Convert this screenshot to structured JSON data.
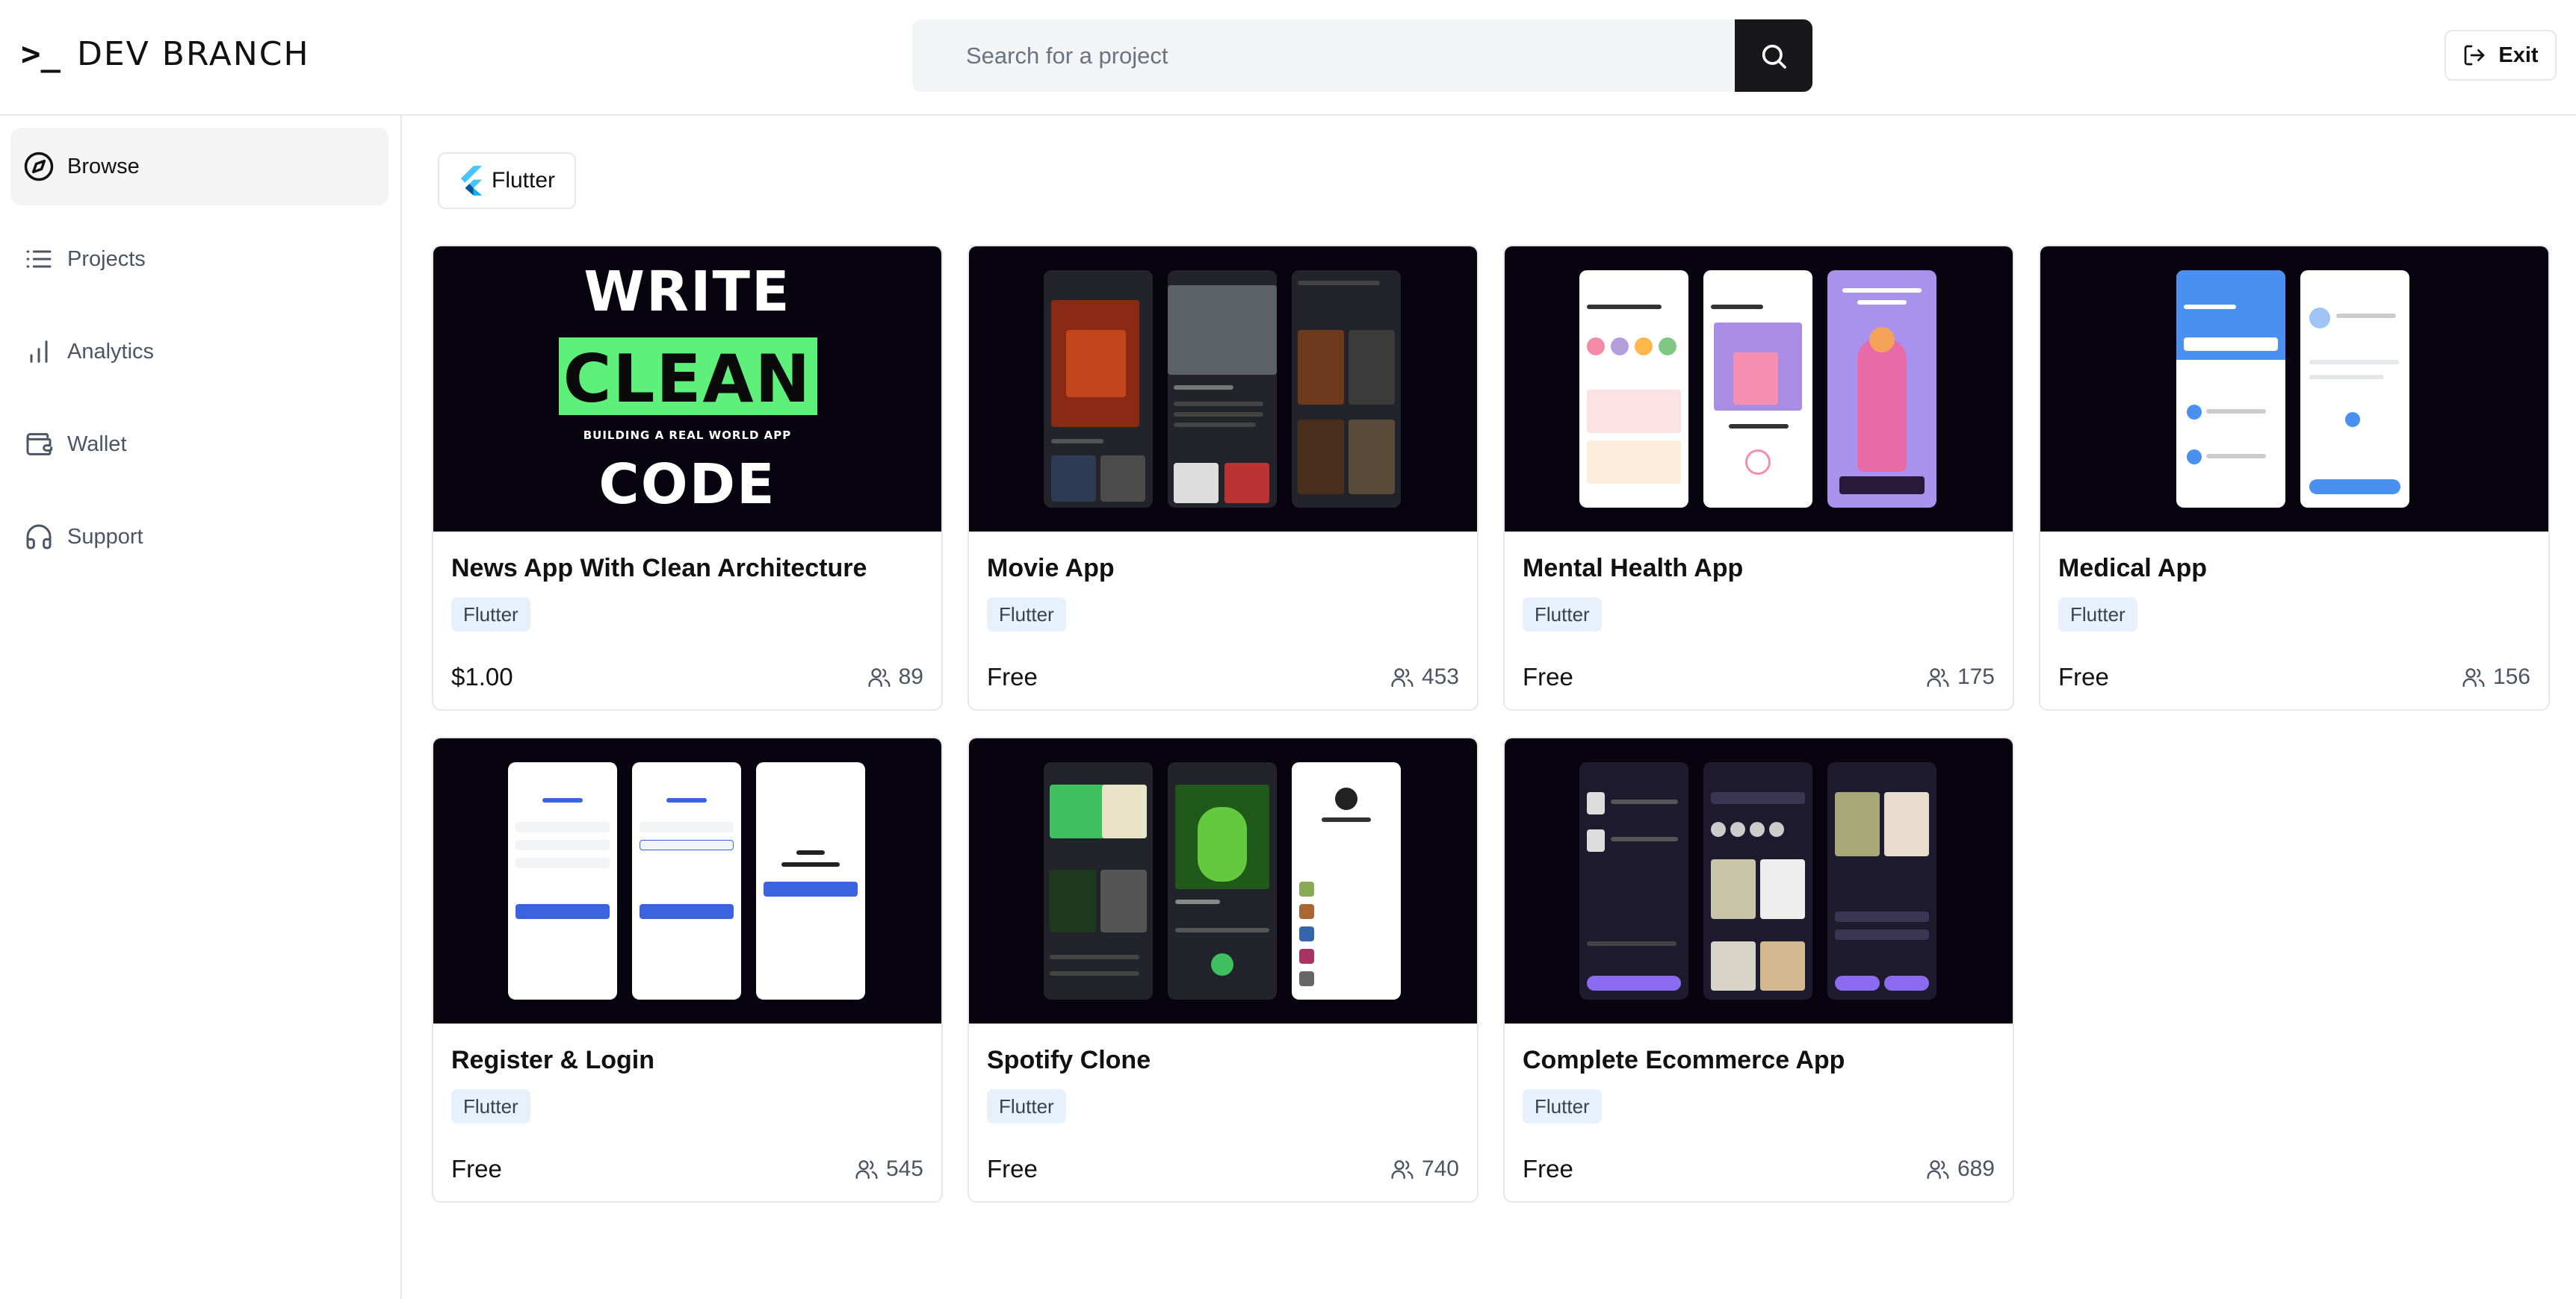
{
  "header": {
    "logo_prompt": ">_",
    "logo_text": "DEV BRANCH",
    "search_placeholder": "Search for a project",
    "exit_label": "Exit"
  },
  "sidebar": {
    "items": [
      {
        "label": "Browse",
        "icon": "compass-icon",
        "active": true
      },
      {
        "label": "Projects",
        "icon": "list-icon",
        "active": false
      },
      {
        "label": "Analytics",
        "icon": "bar-chart-icon",
        "active": false
      },
      {
        "label": "Wallet",
        "icon": "wallet-icon",
        "active": false
      },
      {
        "label": "Support",
        "icon": "headset-icon",
        "active": false
      }
    ]
  },
  "filter": {
    "label": "Flutter",
    "icon": "flutter-logo-icon"
  },
  "thumb_text": {
    "write": "WRITE",
    "clean": "CLEAN",
    "code": "CODE",
    "subtitle": "BUILDING A REAL WORLD APP"
  },
  "projects": [
    {
      "title": "News App With Clean Architecture",
      "tag": "Flutter",
      "price": "$1.00",
      "users": "89"
    },
    {
      "title": "Movie App",
      "tag": "Flutter",
      "price": "Free",
      "users": "453"
    },
    {
      "title": "Mental Health App",
      "tag": "Flutter",
      "price": "Free",
      "users": "175"
    },
    {
      "title": "Medical App",
      "tag": "Flutter",
      "price": "Free",
      "users": "156"
    },
    {
      "title": "Register & Login",
      "tag": "Flutter",
      "price": "Free",
      "users": "545"
    },
    {
      "title": "Spotify Clone",
      "tag": "Flutter",
      "price": "Free",
      "users": "740"
    },
    {
      "title": "Complete Ecommerce App",
      "tag": "Flutter",
      "price": "Free",
      "users": "689"
    }
  ],
  "colors": {
    "accent_dark": "#18181b",
    "tag_bg": "#e8f1fb",
    "clean_green": "#5ef07a",
    "thumb_bg": "#07040f"
  }
}
